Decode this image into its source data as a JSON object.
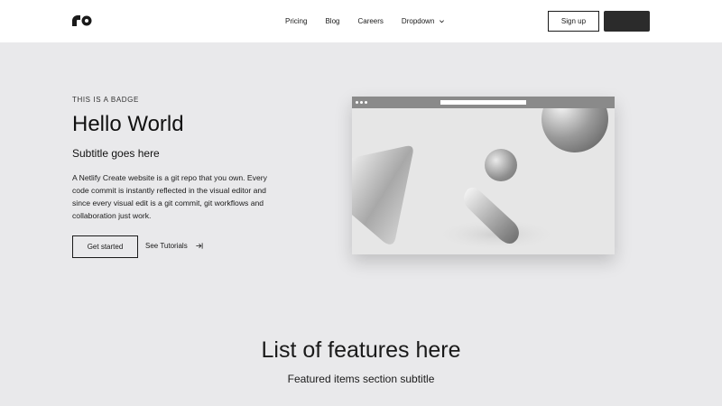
{
  "header": {
    "nav": [
      {
        "label": "Pricing"
      },
      {
        "label": "Blog"
      },
      {
        "label": "Careers"
      },
      {
        "label": "Dropdown",
        "icon": "chevron-down-icon"
      }
    ],
    "signup_label": "Sign up",
    "dark_button_label": ""
  },
  "hero": {
    "badge": "THIS IS A BADGE",
    "title": "Hello World",
    "subtitle": "Subtitle goes here",
    "body": "A Netlify Create website is a git repo that you own. Every code commit is instantly reflected in the visual editor and since every visual edit is a git commit, git workflows and collaboration just work.",
    "primary_button": "Get started",
    "secondary_link": "See Tutorials",
    "secondary_icon": "arrow-right-icon"
  },
  "features": {
    "title": "List of features here",
    "subtitle": "Featured items section subtitle"
  },
  "colors": {
    "page_bg": "#e9e9eb",
    "header_bg": "#ffffff",
    "dark_button": "#2b2b2b",
    "text": "#1a1a1a"
  }
}
